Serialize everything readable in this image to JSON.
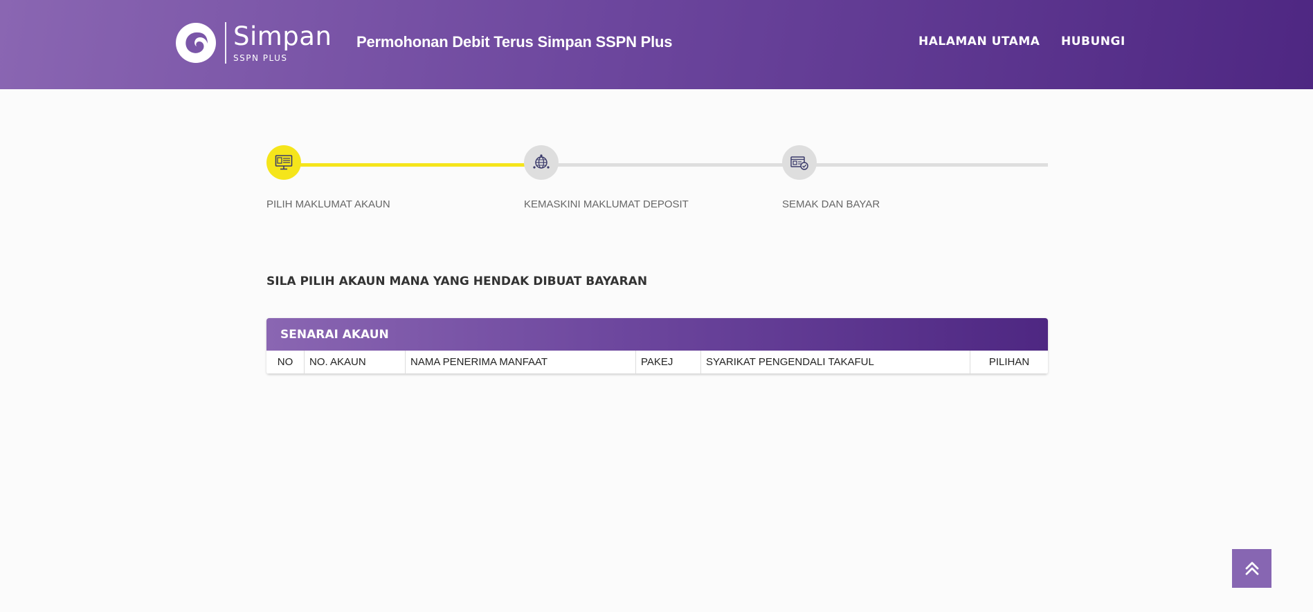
{
  "header": {
    "logo": {
      "name": "Simpan",
      "sub": "SSPN PLUS"
    },
    "title": "Permohonan Debit Terus Simpan SSPN Plus",
    "nav": [
      {
        "label": "HALAMAN UTAMA"
      },
      {
        "label": "HUBUNGI"
      }
    ]
  },
  "stepper": {
    "steps": [
      {
        "label": "PILIH MAKLUMAT AKAUN",
        "icon": "computer-screen-icon",
        "state": "active"
      },
      {
        "label": "KEMASKINI MAKLUMAT DEPOSIT",
        "icon": "globe-network-icon",
        "state": "inactive"
      },
      {
        "label": "SEMAK DAN BAYAR",
        "icon": "id-card-check-icon",
        "state": "inactive"
      }
    ],
    "progress_percent": 33
  },
  "instruction": "SILA PILIH AKAUN MANA YANG HENDAK DIBUAT BAYARAN",
  "account_list": {
    "title": "SENARAI AKAUN",
    "columns": [
      "NO",
      "NO. AKAUN",
      "NAMA PENERIMA MANFAAT",
      "PAKEJ",
      "SYARIKAT PENGENDALI TAKAFUL",
      "PILIHAN"
    ],
    "rows": []
  },
  "scroll_top_icon": "double-chevron-up-icon",
  "colors": {
    "brand_purple_light": "#8a66b2",
    "brand_purple_dark": "#4e2782",
    "step_active": "#f5e51b",
    "step_inactive": "#dedede"
  }
}
